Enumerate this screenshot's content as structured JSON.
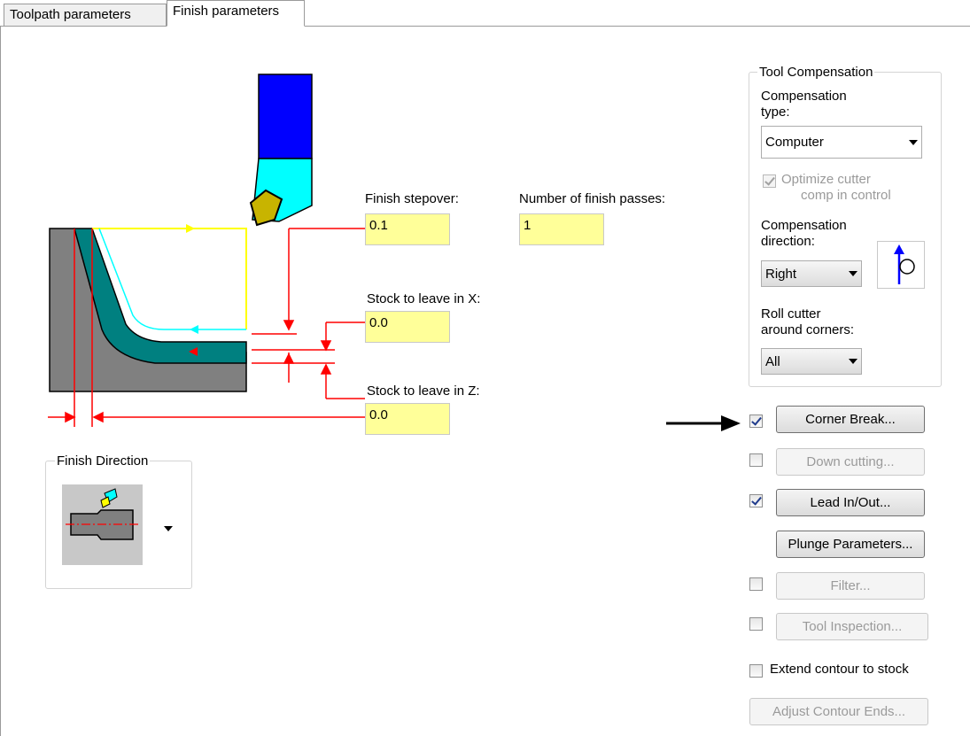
{
  "tabs": [
    {
      "label": "Toolpath parameters"
    },
    {
      "label": "Finish parameters"
    }
  ],
  "fields": {
    "finish_stepover": {
      "label": "Finish stepover:",
      "value": "0.1"
    },
    "finish_passes": {
      "label": "Number of finish passes:",
      "value": "1"
    },
    "stock_x": {
      "label": "Stock to leave in X:",
      "value": "0.0"
    },
    "stock_z": {
      "label": "Stock to leave in Z:",
      "value": "0.0"
    }
  },
  "finish_direction": {
    "title": "Finish Direction"
  },
  "tool_compensation": {
    "title": "Tool Compensation",
    "type_label_1": "Compensation",
    "type_label_2": "type:",
    "type_value": "Computer",
    "optimize_label_1": "Optimize cutter",
    "optimize_label_2": "comp in control",
    "direction_label_1": "Compensation",
    "direction_label_2": "direction:",
    "direction_value": "Right",
    "roll_label_1": "Roll cutter",
    "roll_label_2": "around corners:",
    "roll_value": "All"
  },
  "options": {
    "corner_break": "Corner Break...",
    "down_cutting": "Down cutting...",
    "lead_in_out": "Lead In/Out...",
    "plunge_parameters": "Plunge Parameters...",
    "filter": "Filter...",
    "tool_inspection": "Tool Inspection...",
    "extend_contour": "Extend contour to stock",
    "adjust_contour_ends": "Adjust Contour Ends..."
  },
  "colors": {
    "field_bg": "#ffff99",
    "tool_holder": "#0000ff",
    "tool_shank": "#00ffff",
    "insert": "#c8b400",
    "part": "#808080",
    "finish_pass": "#008080",
    "dimension": "#ff0000",
    "rough_path": "#ffff00"
  }
}
